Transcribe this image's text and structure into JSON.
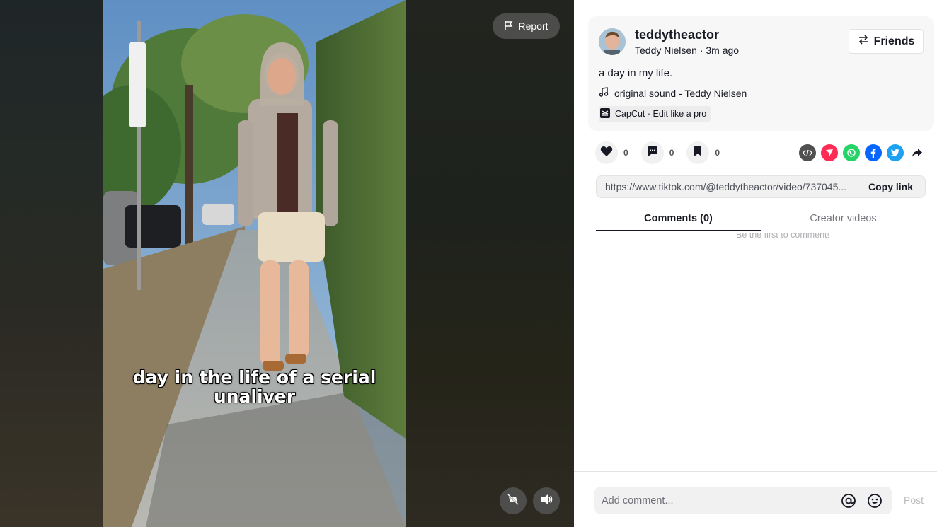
{
  "video": {
    "caption_line1": "day in the life of a serial",
    "caption_line2": "unaliver",
    "report_label": "Report",
    "controls": {
      "float_icon": "float-player-icon",
      "volume_icon": "volume-icon"
    }
  },
  "author": {
    "username": "teddytheactor",
    "display_name": "Teddy Nielsen",
    "separator": " · ",
    "posted": "3m ago",
    "friends_label": "Friends"
  },
  "post": {
    "description": "a day in my life.",
    "sound": "original sound - Teddy Nielsen",
    "capcut_label": "CapCut · Edit like a pro"
  },
  "actions": {
    "likes": "0",
    "comments": "0",
    "saves": "0",
    "share_targets": [
      "embed-icon",
      "send-to-friends-icon",
      "whatsapp-icon",
      "facebook-icon",
      "twitter-icon",
      "share-arrow-icon"
    ]
  },
  "link": {
    "url": "https://www.tiktok.com/@teddytheactor/video/737045...",
    "copy_label": "Copy link"
  },
  "tabs": {
    "comments_label": "Comments (0)",
    "creator_label": "Creator videos"
  },
  "comments": {
    "empty_note": "Be the first to comment!",
    "placeholder": "Add comment...",
    "post_label": "Post"
  },
  "colors": {
    "text": "#161823",
    "whatsapp": "#25D366",
    "facebook": "#0866FF",
    "twitter": "#1DA1F2",
    "send": "#FE2C55",
    "embed": "#505050"
  }
}
